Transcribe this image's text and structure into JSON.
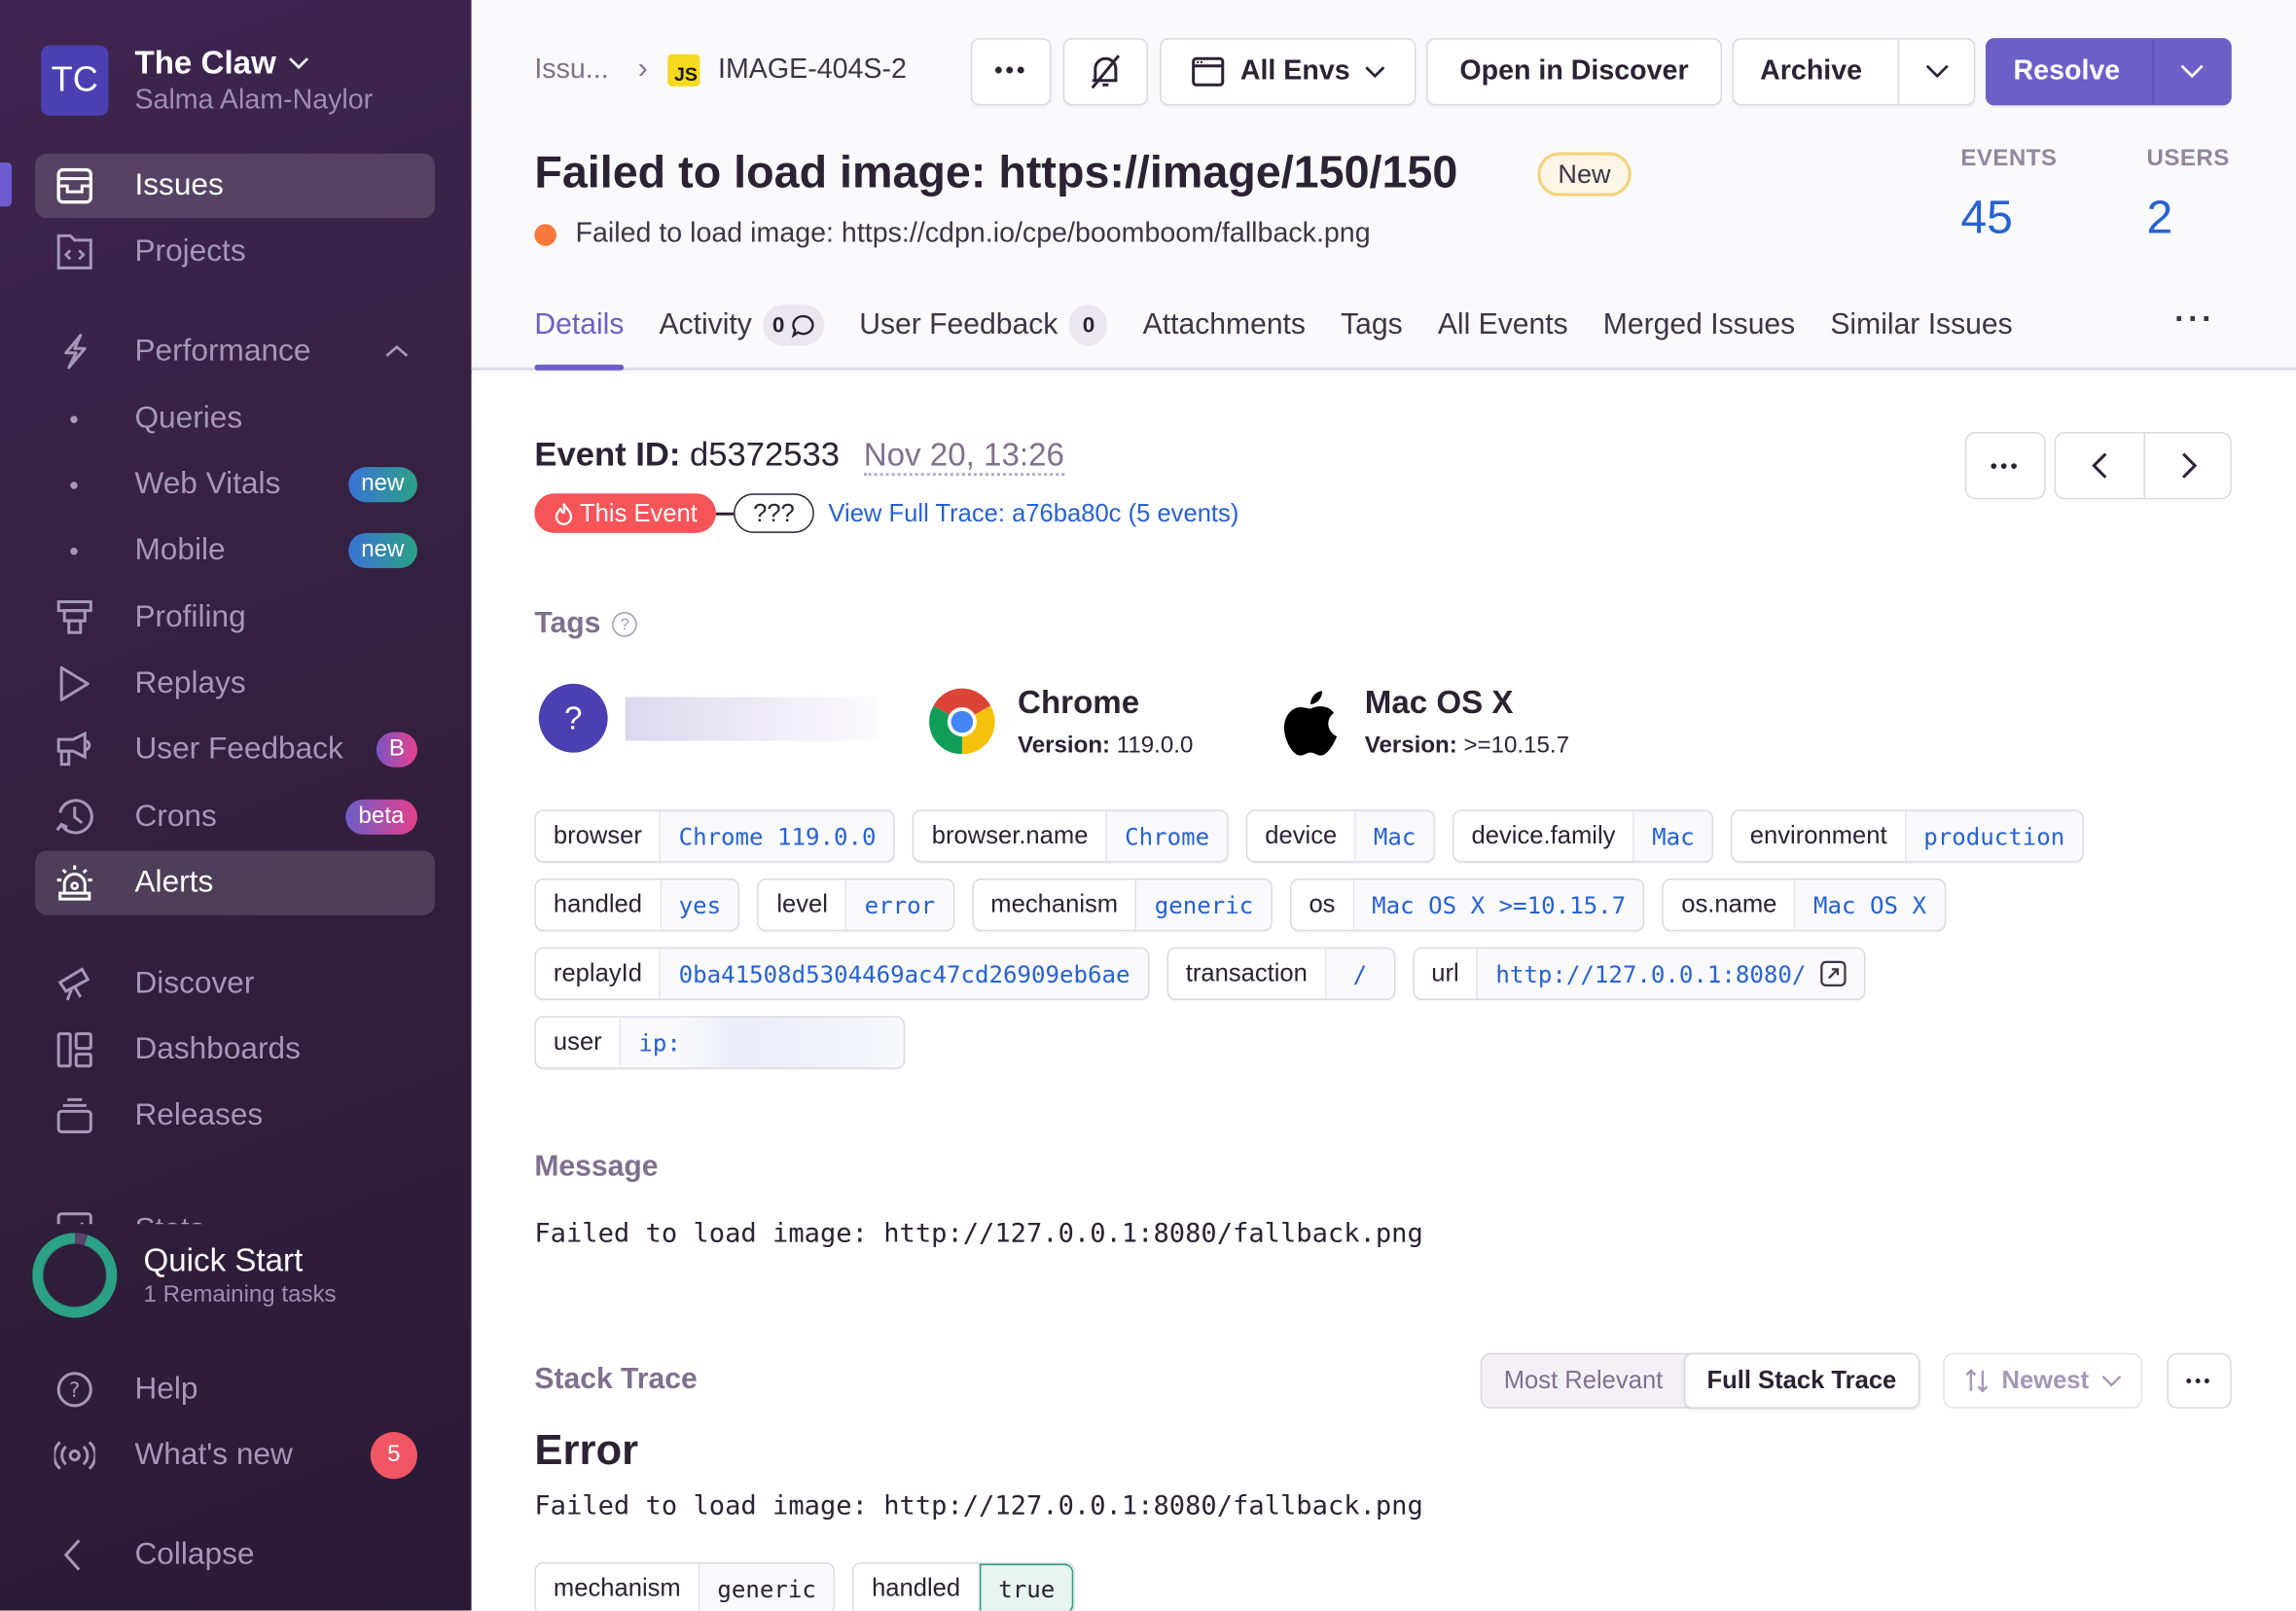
{
  "sidebar": {
    "org_initials": "TC",
    "org_name": "The Claw",
    "user_name": "Salma Alam-Naylor",
    "items": [
      {
        "label": "Issues",
        "icon": "issues-icon",
        "active": true
      },
      {
        "label": "Projects",
        "icon": "projects-icon"
      },
      {
        "label": "Performance",
        "icon": "performance-icon"
      },
      {
        "label": "Queries",
        "icon": "dot"
      },
      {
        "label": "Web Vitals",
        "icon": "dot",
        "badge": "new"
      },
      {
        "label": "Mobile",
        "icon": "dot",
        "badge": "new"
      },
      {
        "label": "Profiling",
        "icon": "profiling-icon"
      },
      {
        "label": "Replays",
        "icon": "replays-icon"
      },
      {
        "label": "User Feedback",
        "icon": "user-feedback-icon",
        "badge": "B"
      },
      {
        "label": "Crons",
        "icon": "crons-icon",
        "badge": "beta"
      },
      {
        "label": "Alerts",
        "icon": "alerts-icon",
        "active": true
      },
      {
        "label": "Discover",
        "icon": "discover-icon"
      },
      {
        "label": "Dashboards",
        "icon": "dashboards-icon"
      },
      {
        "label": "Releases",
        "icon": "releases-icon"
      },
      {
        "label": "Stats",
        "icon": "stats-icon"
      }
    ],
    "quick_start": {
      "count": "1",
      "title": "Quick Start",
      "subtitle": "1 Remaining tasks",
      "progress": 0.95
    },
    "help": "Help",
    "whats_new": "What's new",
    "whats_new_count": "5",
    "collapse": "Collapse"
  },
  "header": {
    "breadcrumb_root": "Issu...",
    "platform_badge": "JS",
    "issue_short_id": "IMAGE-404S-2",
    "env_label": "All Envs",
    "open_discover": "Open in Discover",
    "archive": "Archive",
    "resolve": "Resolve",
    "title": "Failed to load image: https://image/150/150",
    "new_badge": "New",
    "subtitle": "Failed to load image: https://cdpn.io/cpe/boomboom/fallback.png",
    "events_label": "EVENTS",
    "events_value": "45",
    "users_label": "USERS",
    "users_value": "2",
    "tabs": [
      {
        "label": "Details",
        "active": true
      },
      {
        "label": "Activity",
        "count": "0"
      },
      {
        "label": "User Feedback",
        "count": "0"
      },
      {
        "label": "Attachments"
      },
      {
        "label": "Tags"
      },
      {
        "label": "All Events"
      },
      {
        "label": "Merged Issues"
      },
      {
        "label": "Similar Issues"
      }
    ],
    "colors": {
      "accent": "#6c5fc7",
      "link": "#2562d4",
      "level_error": "#f6793a"
    }
  },
  "event": {
    "id_label": "Event ID:",
    "id": "d5372533",
    "date": "Nov 20, 13:26",
    "this_event": "This Event",
    "unknown_node": "???",
    "trace_link": "View Full Trace: a76ba80c (5 events)"
  },
  "tags": {
    "title": "Tags",
    "contexts": [
      {
        "name": "Chrome",
        "version_label": "Version:",
        "version": "119.0.0"
      },
      {
        "name": "Mac OS X",
        "version_label": "Version:",
        "version": ">=10.15.7"
      }
    ],
    "rows": [
      [
        {
          "key": "browser",
          "value": "Chrome 119.0.0"
        },
        {
          "key": "browser.name",
          "value": "Chrome"
        },
        {
          "key": "device",
          "value": "Mac"
        },
        {
          "key": "device.family",
          "value": "Mac"
        },
        {
          "key": "environment",
          "value": "production"
        }
      ],
      [
        {
          "key": "handled",
          "value": "yes"
        },
        {
          "key": "level",
          "value": "error"
        },
        {
          "key": "mechanism",
          "value": "generic"
        },
        {
          "key": "os",
          "value": "Mac OS X >=10.15.7"
        },
        {
          "key": "os.name",
          "value": "Mac OS X"
        }
      ],
      [
        {
          "key": "replayId",
          "value": "0ba41508d5304469ac47cd26909eb6ae"
        },
        {
          "key": "transaction",
          "value": "/"
        },
        {
          "key": "url",
          "value": "http://127.0.0.1:8080/"
        }
      ],
      [
        {
          "key": "user",
          "value": "ip:"
        }
      ]
    ]
  },
  "message": {
    "title": "Message",
    "text": "Failed to load image: http://127.0.0.1:8080/fallback.png"
  },
  "stack": {
    "title": "Stack Trace",
    "most_relevant": "Most Relevant",
    "full_stack": "Full Stack Trace",
    "sort": "Newest",
    "error_type": "Error",
    "error_value": "Failed to load image: http://127.0.0.1:8080/fallback.png",
    "mechanism_key": "mechanism",
    "mechanism_value": "generic",
    "handled_key": "handled",
    "handled_value": "true"
  }
}
